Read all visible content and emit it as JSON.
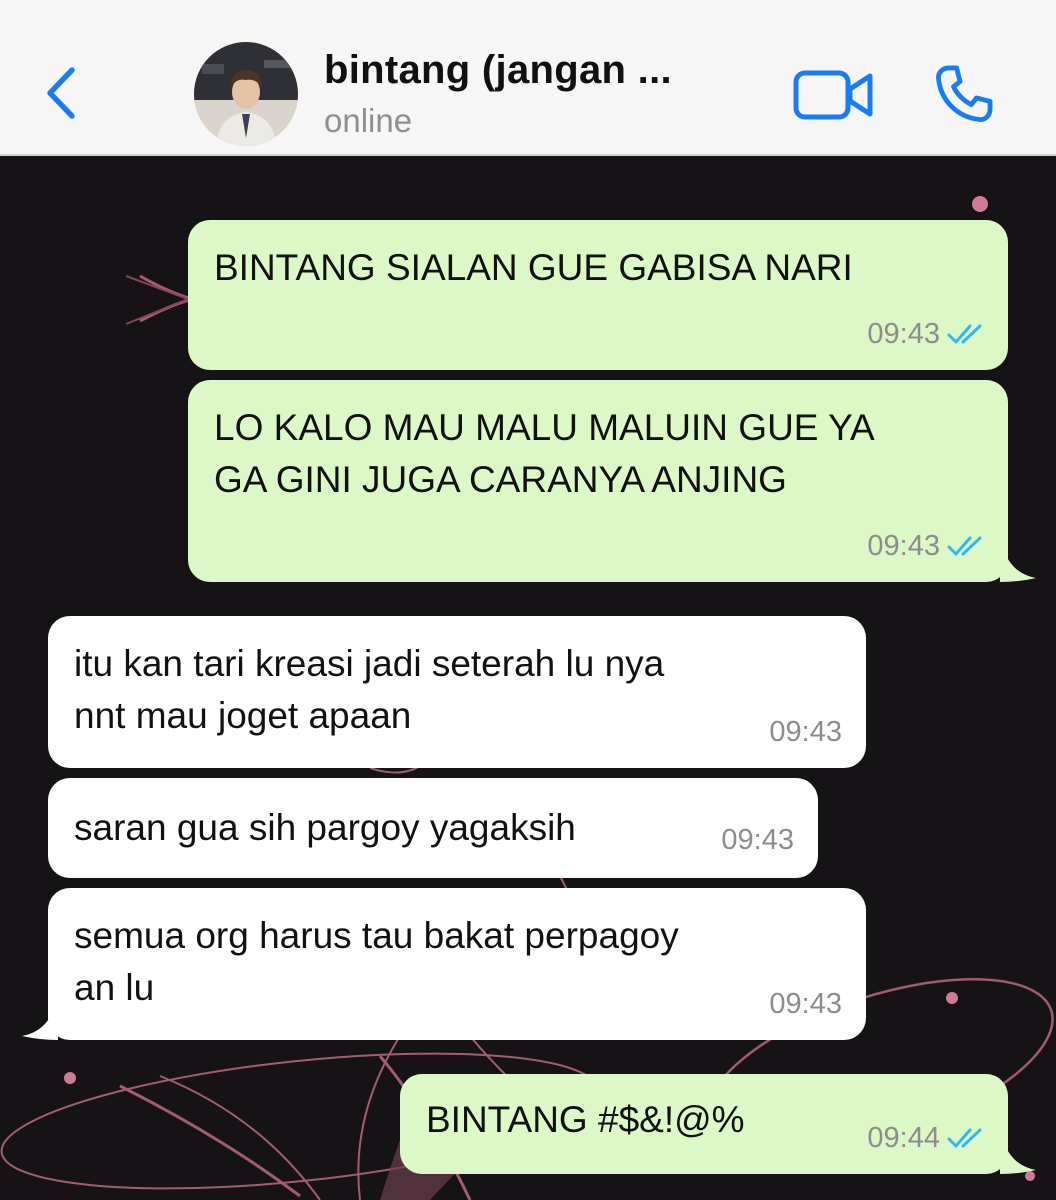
{
  "header": {
    "contact_name": "bintang (jangan ...",
    "status": "online"
  },
  "icons": {
    "back": "chevron-left-icon",
    "video": "video-camera-icon",
    "call": "phone-icon",
    "read_receipt": "double-check-icon"
  },
  "colors": {
    "accent": "#1a7cf5",
    "outgoing_bubble": "#dcf8c6",
    "incoming_bubble": "#ffffff",
    "read_tick": "#34b7f1"
  },
  "messages": [
    {
      "direction": "outgoing",
      "lines": [
        "BINTANG SIALAN GUE GABISA NARI"
      ],
      "time": "09:43",
      "status": "read"
    },
    {
      "direction": "outgoing",
      "lines": [
        "LO KALO MAU MALU MALUIN GUE YA",
        "GA GINI JUGA CARANYA ANJING"
      ],
      "time": "09:43",
      "status": "read"
    },
    {
      "direction": "incoming",
      "lines": [
        "itu kan tari kreasi jadi seterah lu nya",
        "nnt mau joget apaan"
      ],
      "time": "09:43"
    },
    {
      "direction": "incoming",
      "lines": [
        "saran gua sih pargoy yagaksih"
      ],
      "time": "09:43"
    },
    {
      "direction": "incoming",
      "lines": [
        "semua org harus tau bakat perpagoy",
        "an lu"
      ],
      "time": "09:43"
    },
    {
      "direction": "outgoing",
      "lines": [
        "BINTANG #$&!@%"
      ],
      "time": "09:44",
      "status": "read"
    }
  ]
}
